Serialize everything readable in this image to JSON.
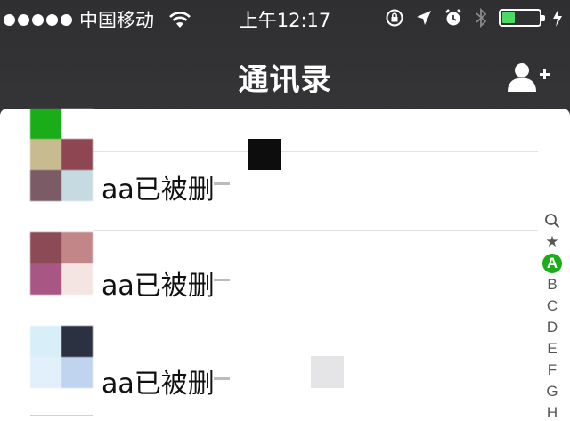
{
  "status_bar": {
    "carrier": "中国移动",
    "time": "上午12:17",
    "battery_color": "#4cd964",
    "icons": [
      "signal-dots-icon",
      "wifi-icon",
      "rotation-lock-icon",
      "location-arrow-icon",
      "alarm-icon",
      "bluetooth-icon",
      "battery-icon",
      "charging-icon"
    ]
  },
  "nav": {
    "title": "通讯录",
    "add_friend_icon": "add-friend-icon"
  },
  "contacts": [
    {
      "name": "aa已被删",
      "avatar_colors": [
        "#1aad19",
        "#ffffff",
        "#c8bb8f",
        "#8e4752",
        "#7b5b66",
        "#c6dbe1"
      ]
    },
    {
      "name": "aa已被删",
      "avatar_colors": [
        "#8c4a56",
        "#c38688",
        "#a85784",
        "#f4e5e2"
      ]
    },
    {
      "name": "aa已被删",
      "avatar_colors": [
        "#d8eef9",
        "#2b3140",
        "#e2f0fb",
        "#c0d3ef"
      ]
    }
  ],
  "index_bar": {
    "items": [
      "Q",
      "★",
      "A",
      "B",
      "C",
      "D",
      "E",
      "F",
      "G",
      "H"
    ],
    "active": "A",
    "active_color": "#1aad19"
  }
}
